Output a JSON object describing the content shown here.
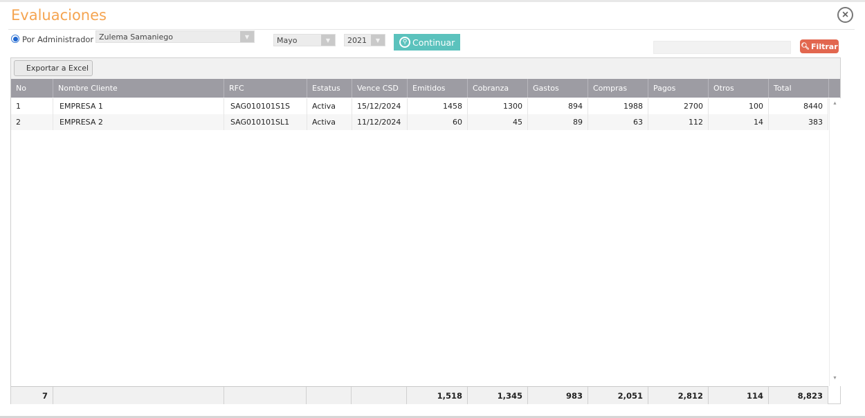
{
  "window": {
    "title": "Evaluaciones",
    "close_glyph": "×"
  },
  "filters": {
    "radio_label": "Por Administrador",
    "admin_value": "Zulema Samaniego",
    "month_value": "Mayo",
    "year_value": "2021",
    "continue_label": "Continuar",
    "filter_label": "Filtrar",
    "search_value": ""
  },
  "toolbar": {
    "export_label": "Exportar a Excel"
  },
  "table": {
    "headers": [
      "No",
      "Nombre Cliente",
      "RFC",
      "Estatus",
      "Vence CSD",
      "Emitidos",
      "Cobranza",
      "Gastos",
      "Compras",
      "Pagos",
      "Otros",
      "Total"
    ],
    "rows": [
      [
        "1",
        "EMPRESA 1",
        "SAG010101S1S",
        "Activa",
        "15/12/2024",
        "1458",
        "1300",
        "894",
        "1988",
        "2700",
        "100",
        "8440"
      ],
      [
        "2",
        "EMPRESA 2",
        "SAG010101SL1",
        "Activa",
        "11/12/2024",
        "60",
        "45",
        "89",
        "63",
        "112",
        "14",
        "383"
      ]
    ],
    "footer": [
      "7",
      "",
      "",
      "",
      "",
      "1,518",
      "1,345",
      "983",
      "2,051",
      "2,812",
      "114",
      "8,823"
    ]
  },
  "icons": {
    "search": "search-icon",
    "close": "close-icon",
    "dropdown": "chevron-down-icon"
  },
  "colors": {
    "title": "#f5a450",
    "continue_button": "#5bc2bd",
    "filter_button": "#e2674f",
    "table_header": "#9d9ca3"
  }
}
